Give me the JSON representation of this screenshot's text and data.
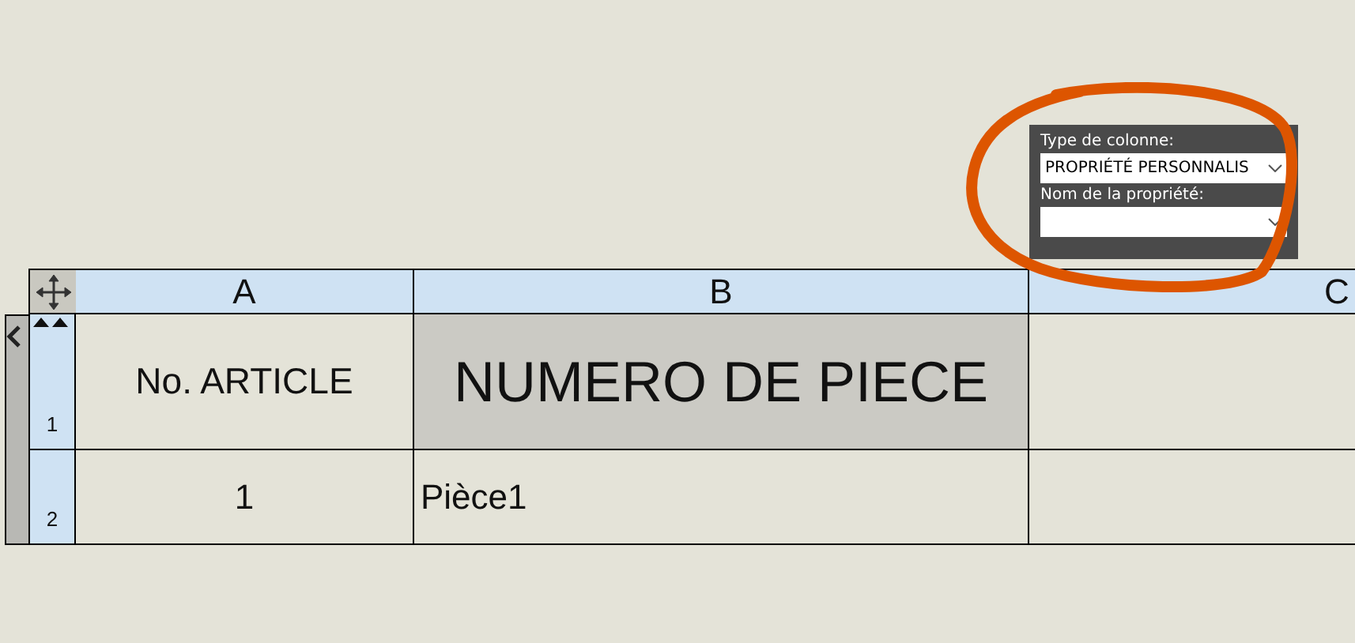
{
  "popup": {
    "column_type_label": "Type de colonne:",
    "column_type_value": "PROPRIÉTÉ PERSONNALIS",
    "property_name_label": "Nom de la propriété:"
  },
  "table": {
    "columns": [
      "A",
      "B",
      "C"
    ],
    "rows": [
      {
        "number": "1",
        "kind": "title",
        "cells": [
          {
            "text": "No. ARTICLE",
            "shaded": false,
            "left_aligned": false
          },
          {
            "text": "NUMERO DE PIECE",
            "shaded": true,
            "left_aligned": false
          },
          {
            "shaded": false
          }
        ]
      },
      {
        "number": "2",
        "kind": "data",
        "cells": [
          {
            "text": "1",
            "shaded": false,
            "left_aligned": false
          },
          {
            "text": "Pièce1",
            "shaded": false,
            "left_aligned": true
          },
          {
            "shaded": false
          }
        ]
      }
    ]
  }
}
